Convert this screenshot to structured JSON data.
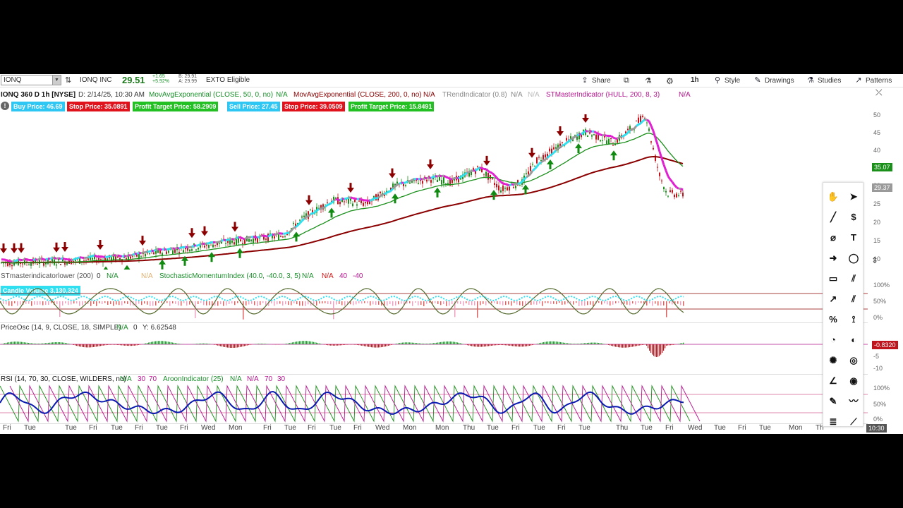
{
  "toolbar": {
    "symbol": "IONQ",
    "company": "IONQ INC",
    "last": "29.51",
    "change_abs": "+1.65",
    "change_pct": "+5.92%",
    "bid": "B: 29.91",
    "ask": "A: 29.99",
    "extended": "EXTO Eligible",
    "share": "Share",
    "timeframe": "1h",
    "style": "Style",
    "drawings": "Drawings",
    "studies": "Studies",
    "patterns": "Patterns"
  },
  "indicators": {
    "title": "IONQ 360 D 1h [NYSE]",
    "date": "D: 2/14/25, 10:30 AM",
    "ma50": "MovAvgExponential (CLOSE, 50, 0, no)",
    "na1": "N/A",
    "ma200": "MovAvgExponential (CLOSE, 200, 0, no)",
    "na2": "N/A",
    "trend": "TRendIndicator (0.8)",
    "na3": "N/A",
    "na4": "N/A",
    "stm": "STMasterIndicator (HULL, 200, 8, 3)",
    "na5": "N/A"
  },
  "labels": {
    "buy": "Buy Price: 46.69",
    "stop1": "Stop Price: 35.0891",
    "target1": "Profit Target Price: 58.2909",
    "sell": "Sell Price: 27.45",
    "stop2": "Stop Price: 39.0509",
    "target2": "Profit Target Price: 15.8491"
  },
  "price_axis": {
    "ticks": [
      "50",
      "45",
      "40",
      "35",
      "30",
      "25",
      "20",
      "15",
      "10"
    ],
    "tag_green": "35.07",
    "tag_gray": "29.37"
  },
  "lower1": {
    "name": "STmasterindicatorlower (200)",
    "v0": "0",
    "na1": "N/A",
    "na2": "N/A",
    "smi": "StochasticMomentumIndex (40.0, -40.0, 3, 5)",
    "na3": "N/A",
    "na4": "N/A",
    "v40": "40",
    "vm40": "-40",
    "candle_vol": "Candle Volume 3,130,324",
    "axis": [
      "100%",
      "50%",
      "0%"
    ]
  },
  "lower2": {
    "name": "PriceOsc (14, 9, CLOSE, 18, SIMPLE)",
    "na": "N/A",
    "v0": "0",
    "y": "Y: 6.62548",
    "tag": "-0.8320",
    "axis": [
      "-5",
      "-10"
    ]
  },
  "lower3": {
    "rsi": "RSI (14, 70, 30, CLOSE, WILDERS, no)",
    "na1": "N/A",
    "v30": "30",
    "v70": "70",
    "aroon": "AroonIndicator (25)",
    "na2": "N/A",
    "na3": "N/A",
    "v70b": "70",
    "v30b": "30",
    "axis": [
      "100%",
      "50%",
      "0%"
    ]
  },
  "xaxis": [
    "Fri",
    "Tue",
    "Tue",
    "Fri",
    "Tue",
    "Fri",
    "Tue",
    "Fri",
    "Wed",
    "Mon",
    "Fri",
    "Tue",
    "Fri",
    "Tue",
    "Fri",
    "Wed",
    "Mon",
    "Mon",
    "Thu",
    "Tue",
    "Fri",
    "Tue",
    "Fri",
    "Tue",
    "Thu",
    "Tue",
    "Fri",
    "Wed",
    "Tue",
    "Fri",
    "Tue",
    "Mon",
    "Th"
  ],
  "time_tag": "10:30",
  "colors": {
    "buy": "#2ec6f2",
    "stop": "#e0121c",
    "target": "#22c022",
    "sell": "#2ec6f2",
    "ma50": "#1a8f1a",
    "ma200": "#8b0000",
    "hull_up": "#e020d0",
    "hull_down": "#30e0f0"
  },
  "icons": [
    "hand-icon",
    "pointer-icon",
    "line-icon",
    "price-level-icon",
    "fib-icon",
    "text-icon",
    "arrow-icon",
    "ellipse-icon",
    "rectangle-icon",
    "channel-icon",
    "ray-icon",
    "parallel-icon",
    "percent-icon",
    "gann-icon",
    "fib-fan-icon",
    "fib-arc-icon",
    "spiral-icon",
    "circle-icon",
    "angle-icon",
    "target-icon",
    "pencil-icon",
    "wave-icon",
    "list-icon",
    "fan-icon"
  ]
}
